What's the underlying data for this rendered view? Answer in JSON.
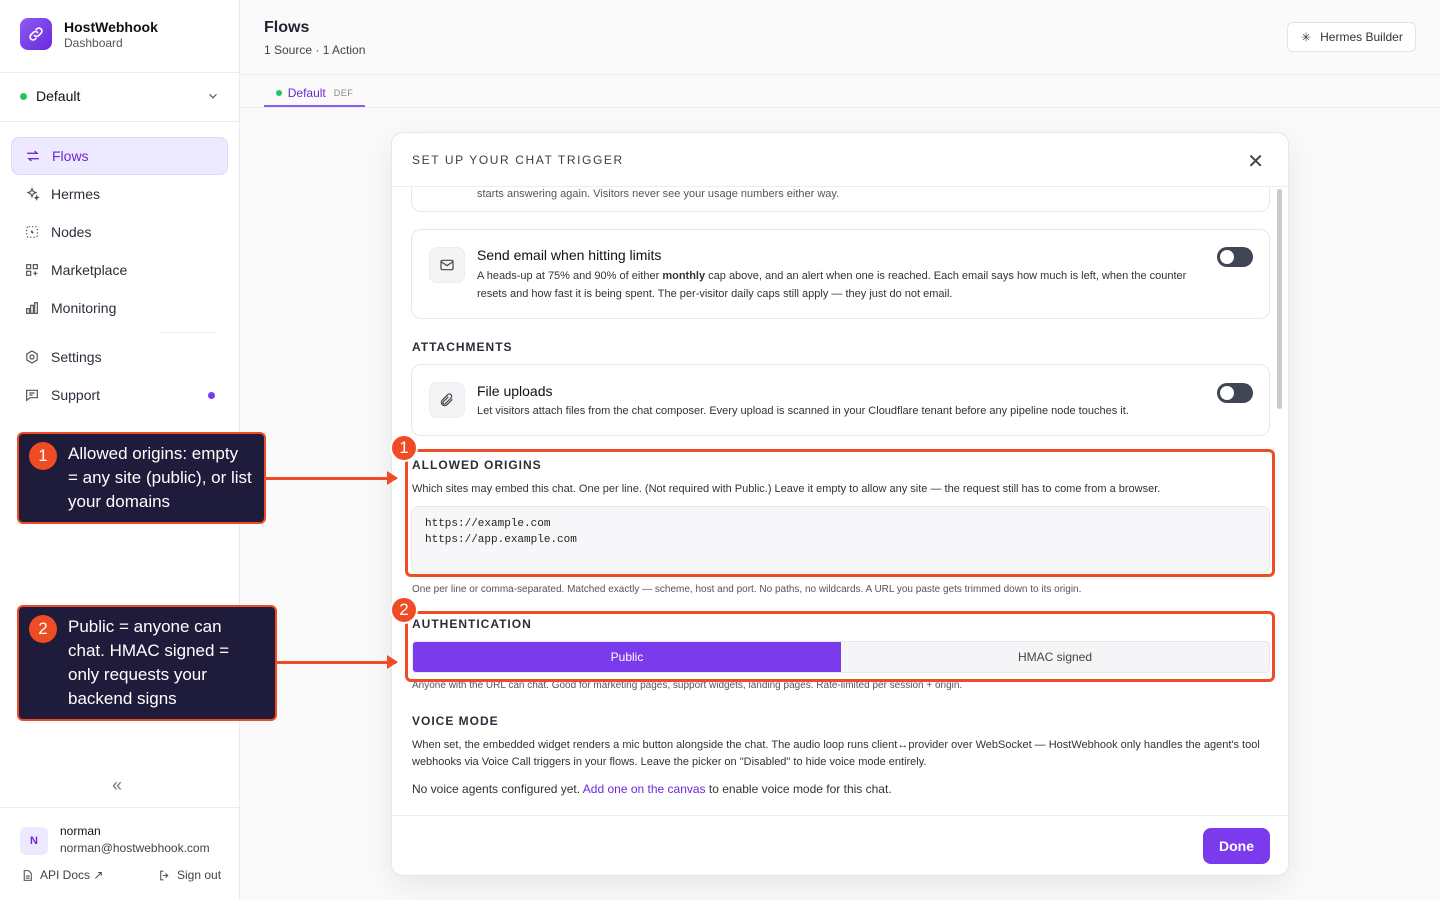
{
  "brand": {
    "name": "HostWebhook",
    "subtitle": "Dashboard"
  },
  "workspace": {
    "name": "Default"
  },
  "nav": [
    {
      "label": "Flows",
      "icon": "arrows-swap-icon",
      "active": true
    },
    {
      "label": "Hermes",
      "icon": "sparkles-icon"
    },
    {
      "label": "Nodes",
      "icon": "nodes-icon"
    },
    {
      "label": "Marketplace",
      "icon": "grid-icon"
    },
    {
      "label": "Monitoring",
      "icon": "bar-chart-icon"
    },
    {
      "label": "Settings",
      "icon": "gear-icon"
    },
    {
      "label": "Support",
      "icon": "chat-icon",
      "badge": true
    }
  ],
  "collapse_glyph": "«",
  "user": {
    "initial": "N",
    "name": "norman",
    "email": "norman@hostwebhook.com"
  },
  "footer": {
    "api_docs": "API Docs ↗",
    "sign_out": "Sign out"
  },
  "header": {
    "title": "Flows",
    "subtitle": "1 Source · 1 Action",
    "hermes_button": "Hermes Builder"
  },
  "tab": {
    "label": "Default",
    "badge": "DEF"
  },
  "modal": {
    "title": "SET UP YOUR CHAT TRIGGER",
    "close": "✕",
    "clipped_text": "starts answering again. Visitors never see your usage numbers either way.",
    "email_limits": {
      "title": "Send email when hitting limits",
      "desc_a": "A heads-up at 75% and 90% of either ",
      "desc_bold": "monthly",
      "desc_b": " cap above, and an alert when one is reached. Each email says how much is left, when the counter resets and how fast it is being spent. The per-visitor daily caps still apply — they just do not email."
    },
    "attachments": {
      "heading": "ATTACHMENTS",
      "title": "File uploads",
      "desc": "Let visitors attach files from the chat composer. Every upload is scanned in your Cloudflare tenant before any pipeline node touches it."
    },
    "origins": {
      "heading": "ALLOWED ORIGINS",
      "desc": "Which sites may embed this chat. One per line. (Not required with Public.) Leave it empty to allow any site — the request still has to come from a browser.",
      "lines": [
        "https://example.com",
        "https://app.example.com"
      ],
      "hint": "One per line or comma-separated. Matched exactly — scheme, host and port. No paths, no wildcards. A URL you paste gets trimmed down to its origin."
    },
    "auth": {
      "heading": "AUTHENTICATION",
      "options": [
        "Public",
        "HMAC signed"
      ],
      "selected": "Public",
      "hint": "Anyone with the URL can chat. Good for marketing pages, support widgets, landing pages. Rate-limited per session + origin."
    },
    "voice": {
      "heading": "VOICE MODE",
      "desc": "When set, the embedded widget renders a mic button alongside the chat. The audio loop runs client↔provider over WebSocket — HostWebhook only handles the agent's tool webhooks via Voice Call triggers in your flows. Leave the picker on \"Disabled\" to hide voice mode entirely.",
      "empty_a": "No voice agents configured yet. ",
      "empty_link": "Add one on the canvas",
      "empty_b": " to enable voice mode for this chat."
    },
    "done": "Done"
  },
  "annotations": [
    {
      "num": "1",
      "text": "Allowed origins: empty = any site (public), or list your domains"
    },
    {
      "num": "2",
      "text": "Public = anyone can chat. HMAC signed = only requests your backend signs"
    }
  ],
  "colors": {
    "accent": "#7c3aed",
    "annotation": "#ef4b25",
    "callout_bg": "#1f1b3a",
    "status_dot": "#22c55e"
  }
}
